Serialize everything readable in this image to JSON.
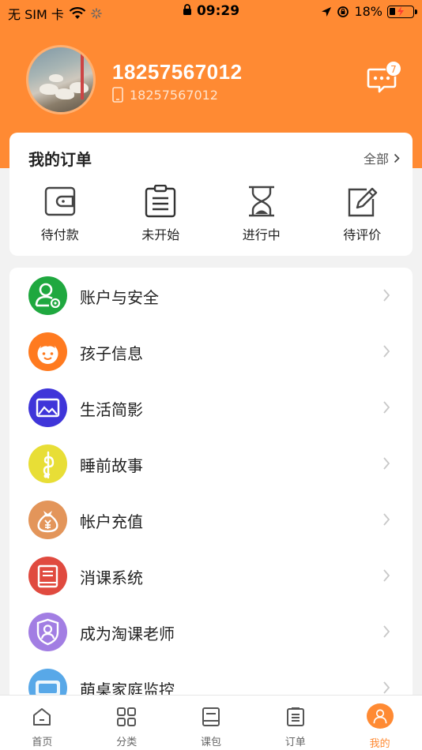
{
  "status_bar": {
    "carrier": "无 SIM 卡",
    "time": "09:29",
    "battery": "18%"
  },
  "profile": {
    "phone_main": "18257567012",
    "phone_sub": "18257567012",
    "message_badge": "7"
  },
  "orders": {
    "title": "我的订单",
    "all_label": "全部",
    "items": [
      {
        "label": "待付款",
        "icon": "wallet-icon"
      },
      {
        "label": "未开始",
        "icon": "clipboard-icon"
      },
      {
        "label": "进行中",
        "icon": "hourglass-icon"
      },
      {
        "label": "待评价",
        "icon": "edit-icon"
      }
    ]
  },
  "menu": {
    "items": [
      {
        "label": "账户与安全",
        "icon": "account-security-icon",
        "color": "#1fa83f"
      },
      {
        "label": "孩子信息",
        "icon": "child-face-icon",
        "color": "#ff7a1f"
      },
      {
        "label": "生活简影",
        "icon": "image-icon",
        "color": "#3f35d9"
      },
      {
        "label": "睡前故事",
        "icon": "music-note-icon",
        "color": "#e8de36"
      },
      {
        "label": "帐户充值",
        "icon": "money-bag-icon",
        "color": "#e3955a"
      },
      {
        "label": "消课系统",
        "icon": "book-icon",
        "color": "#e04a3f"
      },
      {
        "label": "成为淘课老师",
        "icon": "teacher-badge-icon",
        "color": "#a27ee3"
      },
      {
        "label": "萌桌家庭监控",
        "icon": "monitor-logo-icon",
        "color": "#58a8e8"
      }
    ]
  },
  "tabs": [
    {
      "label": "首页",
      "icon": "home-icon"
    },
    {
      "label": "分类",
      "icon": "grid-icon"
    },
    {
      "label": "课包",
      "icon": "course-package-icon"
    },
    {
      "label": "订单",
      "icon": "order-list-icon"
    },
    {
      "label": "我的",
      "icon": "user-icon",
      "active": true
    }
  ],
  "colors": {
    "accent": "#ff8a33",
    "background": "#f2f2f2"
  }
}
